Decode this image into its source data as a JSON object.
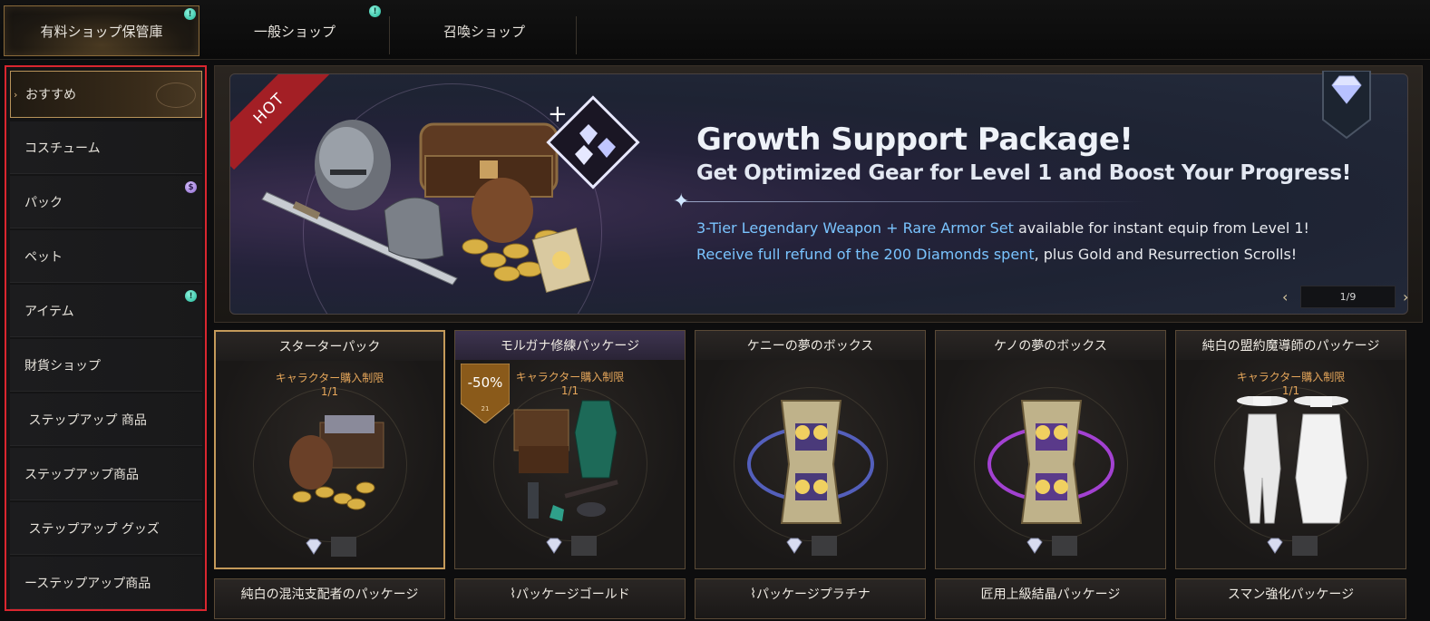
{
  "top_tabs": [
    {
      "label": "有料ショップ保管庫",
      "active": true,
      "badge": "!"
    },
    {
      "label": "一般ショップ",
      "active": false,
      "badge": "!"
    },
    {
      "label": "召喚ショップ",
      "active": false
    }
  ],
  "sidebar": {
    "items": [
      {
        "label": "おすすめ",
        "active": true
      },
      {
        "label": "コスチューム"
      },
      {
        "label": "パック",
        "badge": "$"
      },
      {
        "label": "ペット"
      },
      {
        "label": "アイテム",
        "badge": "!"
      },
      {
        "label": "財貨ショップ"
      },
      {
        "label": " ステップアップ 商品"
      },
      {
        "label": "ステップアップ商品"
      },
      {
        "label": " ステップアップ グッズ"
      },
      {
        "label": "ーステップアップ商品"
      }
    ]
  },
  "banner": {
    "hot": "HOT",
    "title": "Growth Support Package!",
    "subtitle": "Get Optimized Gear for Level 1 and Boost Your Progress!",
    "line1_highlight": "3-Tier Legendary Weapon + Rare Armor Set",
    "line1_rest": " available for instant equip from Level 1!",
    "line2_highlight": "Receive full refund of the 200 Diamonds spent",
    "line2_rest": ", plus Gold and Resurrection Scrolls!",
    "pager": "1/9"
  },
  "products": [
    {
      "title": "スターターパック",
      "limit_label": "キャラクター購入制限",
      "limit": "1/1"
    },
    {
      "title": "モルガナ修練パッケージ",
      "limit_label": "キャラクター購入制限",
      "limit": "1/1",
      "discount": "-50%",
      "discount_sub": "21"
    },
    {
      "title": "ケニーの夢のボックス"
    },
    {
      "title": "ケノの夢のボックス"
    },
    {
      "title": "純白の盟約魔導師のパッケージ",
      "limit_label": "キャラクター購入制限",
      "limit": "1/1"
    }
  ],
  "products_row2": [
    {
      "title": "純白の混沌支配者のパッケージ"
    },
    {
      "title": "パッケージゴールド",
      "prefix": "⌇"
    },
    {
      "title": "パッケージプラチナ",
      "prefix": "⌇"
    },
    {
      "title": "匠用上級結晶パッケージ"
    },
    {
      "title": "スマン強化パッケージ"
    }
  ],
  "colors": {
    "accent_gold": "#c49a5a",
    "highlight_blue": "#7ac4ff",
    "limit_orange": "#e5a65a",
    "hot_red": "#a31f25",
    "sidebar_border": "#d9262f"
  }
}
